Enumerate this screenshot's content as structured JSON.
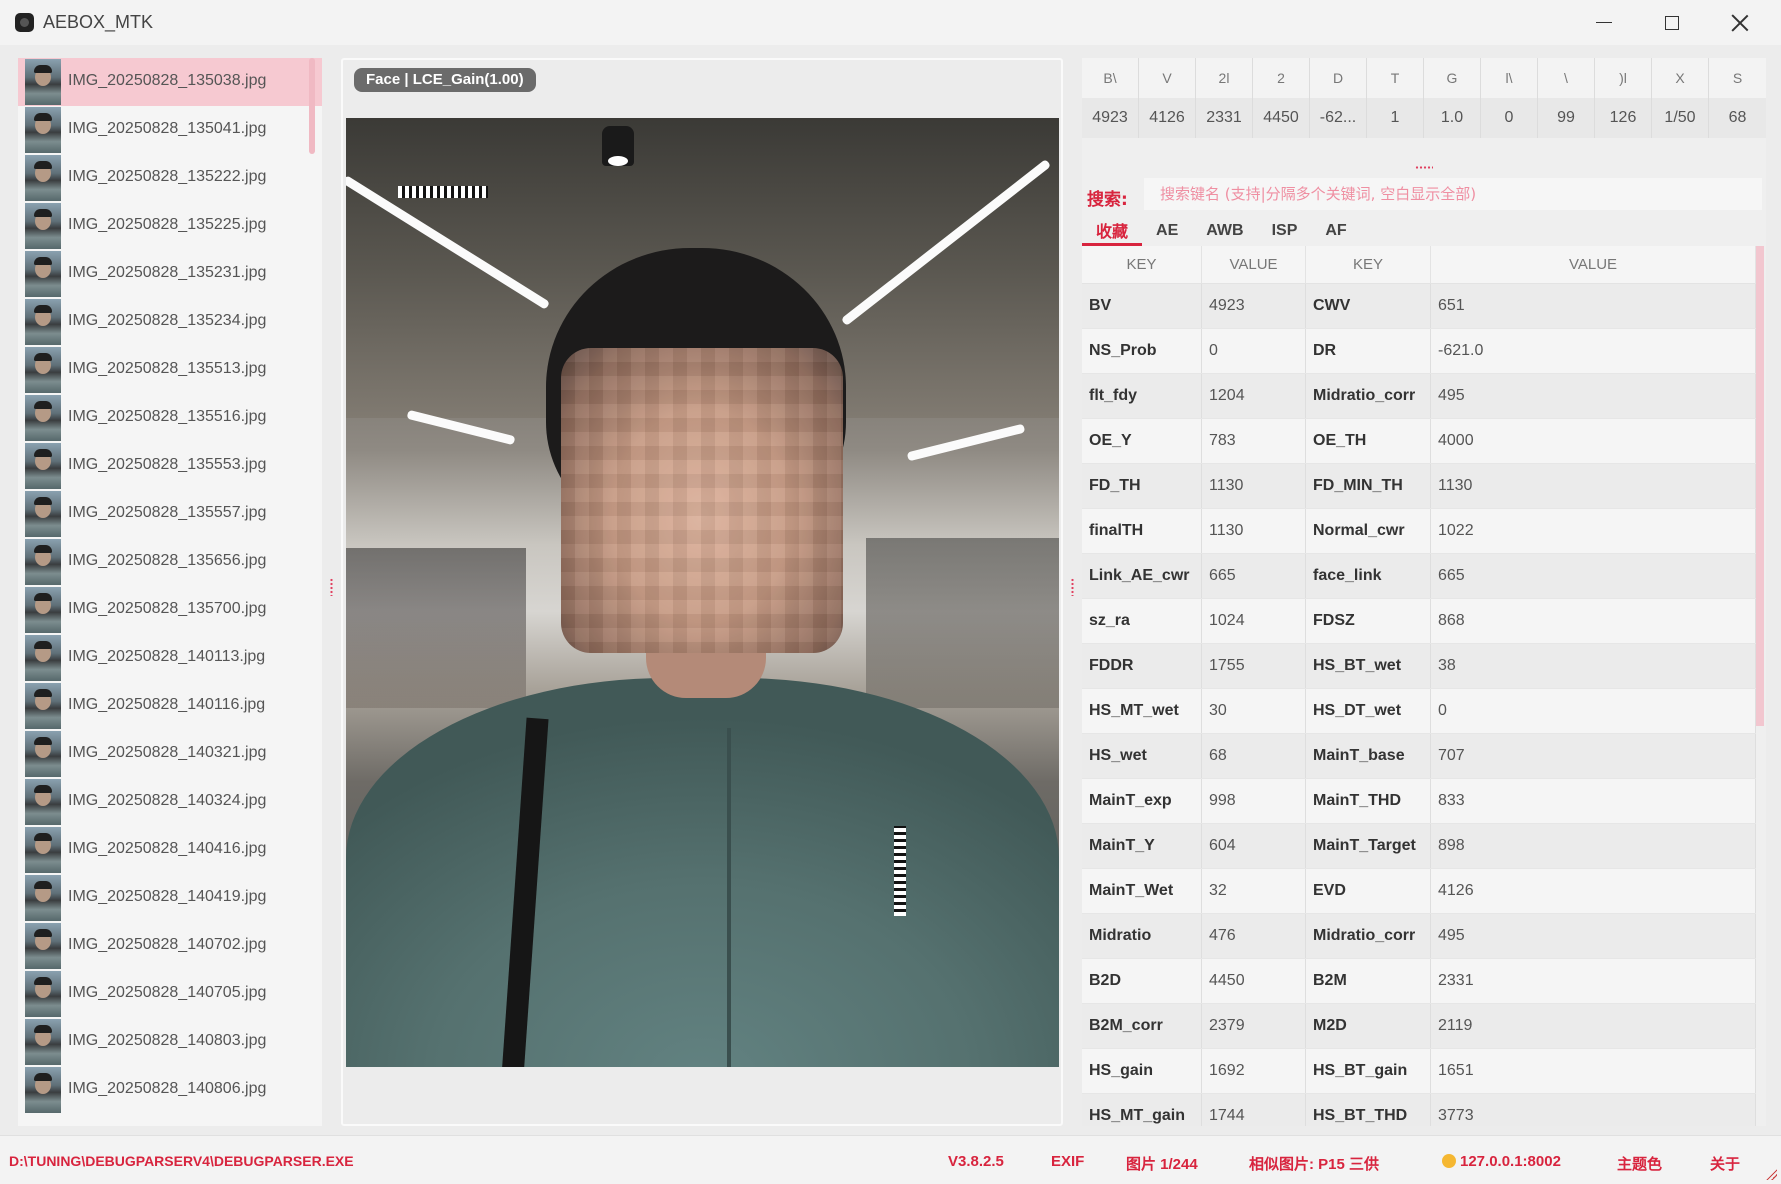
{
  "app": {
    "title": "AEBOX_MTK"
  },
  "files": [
    "IMG_20250828_135038.jpg",
    "IMG_20250828_135041.jpg",
    "IMG_20250828_135222.jpg",
    "IMG_20250828_135225.jpg",
    "IMG_20250828_135231.jpg",
    "IMG_20250828_135234.jpg",
    "IMG_20250828_135513.jpg",
    "IMG_20250828_135516.jpg",
    "IMG_20250828_135553.jpg",
    "IMG_20250828_135557.jpg",
    "IMG_20250828_135656.jpg",
    "IMG_20250828_135700.jpg",
    "IMG_20250828_140113.jpg",
    "IMG_20250828_140116.jpg",
    "IMG_20250828_140321.jpg",
    "IMG_20250828_140324.jpg",
    "IMG_20250828_140416.jpg",
    "IMG_20250828_140419.jpg",
    "IMG_20250828_140702.jpg",
    "IMG_20250828_140705.jpg",
    "IMG_20250828_140803.jpg",
    "IMG_20250828_140806.jpg"
  ],
  "selected_file_index": 0,
  "viewer": {
    "badge": "Face | LCE_Gain(1.00)"
  },
  "stats": {
    "headers": [
      "B\\",
      "V",
      "2l",
      "2",
      "D",
      "T",
      "G",
      "l\\",
      "\\",
      ")l",
      "X",
      "S"
    ],
    "values": [
      "4923",
      "4126",
      "2331",
      "4450",
      "-62...",
      "1",
      "1.0",
      "0",
      "99",
      "126",
      "1/50",
      "68"
    ]
  },
  "search": {
    "label": "搜索:",
    "placeholder": "搜索键名 (支持|分隔多个关键词, 空白显示全部)"
  },
  "tabs": [
    "收藏",
    "AE",
    "AWB",
    "ISP",
    "AF"
  ],
  "active_tab_index": 0,
  "table": {
    "headers": [
      "KEY",
      "VALUE",
      "KEY",
      "VALUE"
    ],
    "rows": [
      [
        "BV",
        "4923",
        "CWV",
        "651"
      ],
      [
        "NS_Prob",
        "0",
        "DR",
        "-621.0"
      ],
      [
        "flt_fdy",
        "1204",
        "Midratio_corr",
        "495"
      ],
      [
        "OE_Y",
        "783",
        "OE_TH",
        "4000"
      ],
      [
        "FD_TH",
        "1130",
        "FD_MIN_TH",
        "1130"
      ],
      [
        "finalTH",
        "1130",
        "Normal_cwr",
        "1022"
      ],
      [
        "Link_AE_cwr",
        "665",
        "face_link",
        "665"
      ],
      [
        "sz_ra",
        "1024",
        "FDSZ",
        "868"
      ],
      [
        "FDDR",
        "1755",
        "HS_BT_wet",
        "38"
      ],
      [
        "HS_MT_wet",
        "30",
        "HS_DT_wet",
        "0"
      ],
      [
        "HS_wet",
        "68",
        "MainT_base",
        "707"
      ],
      [
        "MainT_exp",
        "998",
        "MainT_THD",
        "833"
      ],
      [
        "MainT_Y",
        "604",
        "MainT_Target",
        "898"
      ],
      [
        "MainT_Wet",
        "32",
        "EVD",
        "4126"
      ],
      [
        "Midratio",
        "476",
        "Midratio_corr",
        "495"
      ],
      [
        "B2D",
        "4450",
        "B2M",
        "2331"
      ],
      [
        "B2M_corr",
        "2379",
        "M2D",
        "2119"
      ],
      [
        "HS_gain",
        "1692",
        "HS_BT_gain",
        "1651"
      ],
      [
        "HS_MT_gain",
        "1744",
        "HS_BT_THD",
        "3773"
      ]
    ]
  },
  "status": {
    "path": "D:\\TUNING\\DEBUGPARSERV4\\DEBUGPARSER.EXE",
    "version": "V3.8.2.5",
    "exif": "EXIF",
    "image_count": "图片 1/244",
    "similar": "相似图片: P15 三供",
    "server": "127.0.0.1:8002",
    "theme": "主题色",
    "about": "关于"
  },
  "colors": {
    "accent": "#d8243e",
    "selected_row": "#f6c9d1",
    "placeholder": "#ef8fa2"
  }
}
